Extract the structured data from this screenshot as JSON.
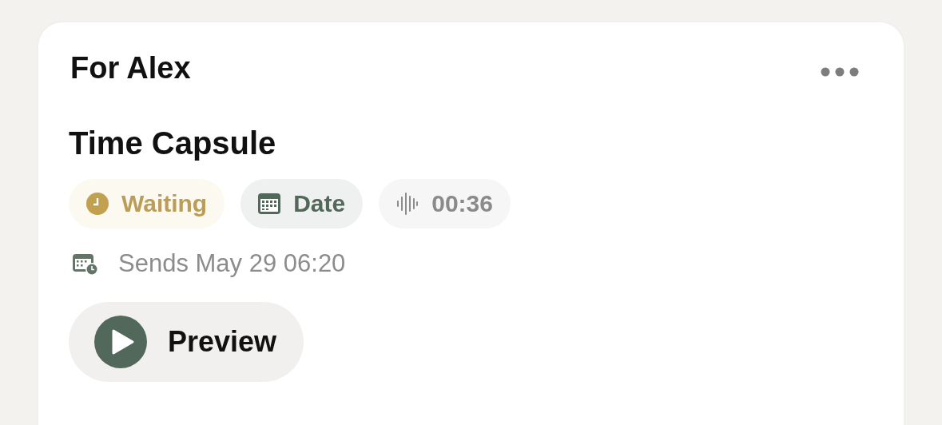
{
  "card": {
    "recipient": "For Alex",
    "title": "Time Capsule",
    "tags": [
      {
        "kind": "status",
        "label": "Waiting"
      },
      {
        "kind": "date",
        "label": "Date"
      },
      {
        "kind": "duration",
        "label": "00:36"
      }
    ],
    "schedule": "Sends May 29 06:20",
    "preview_button": "Preview"
  }
}
